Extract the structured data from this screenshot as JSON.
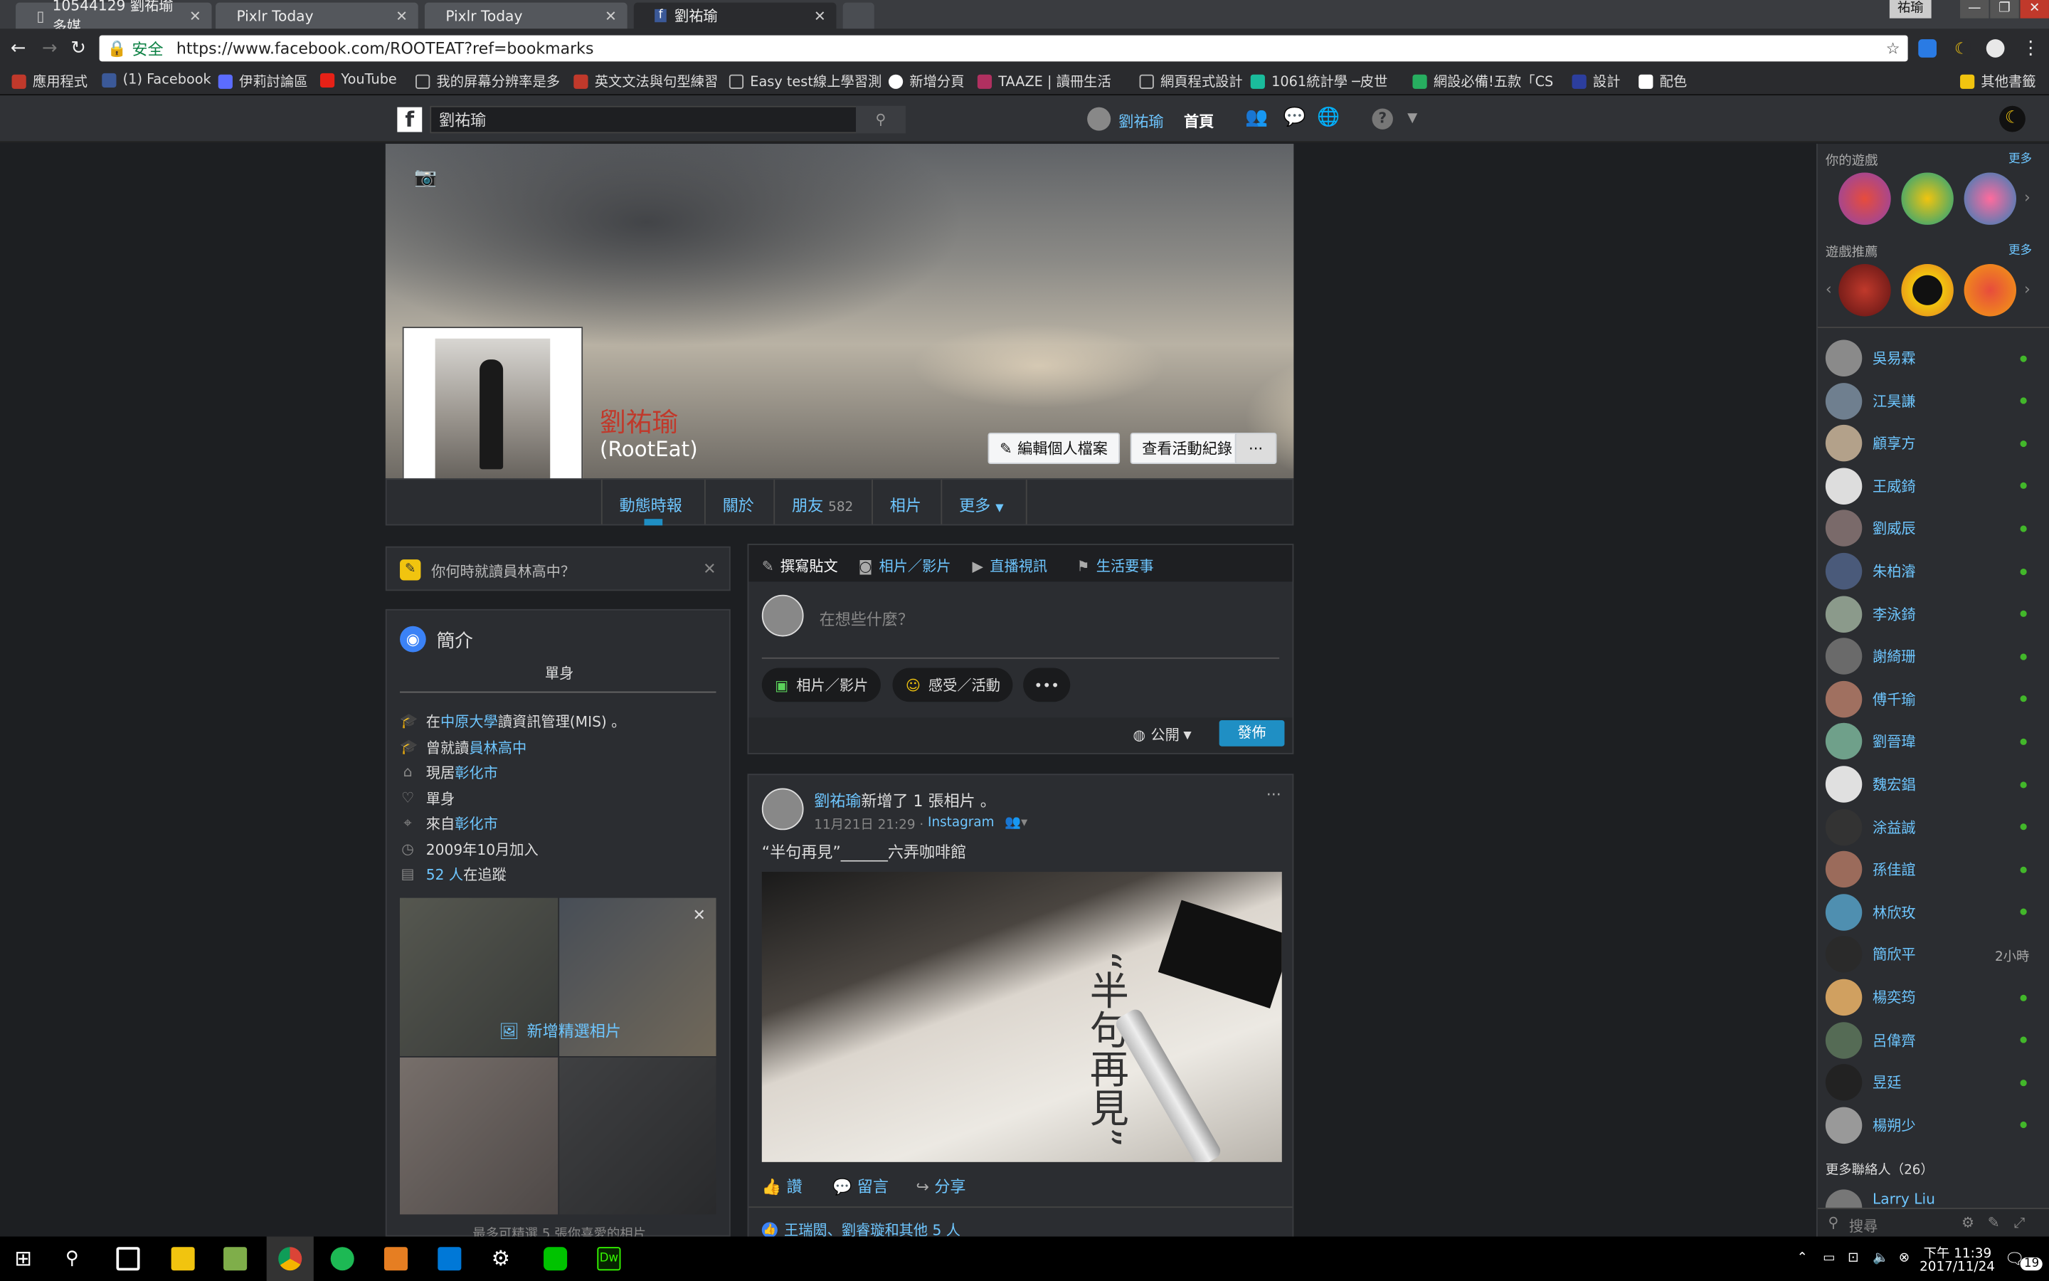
{
  "browser": {
    "tabs": [
      {
        "title": "10544129 劉祐瑜 多媒",
        "active": false
      },
      {
        "title": "Pixlr Today",
        "active": false
      },
      {
        "title": "Pixlr Today",
        "active": false
      },
      {
        "title": "劉祐瑜",
        "active": true
      }
    ],
    "user_chip": "祐瑜",
    "secure_label": "安全",
    "url": "https://www.facebook.com/ROOTEAT?ref=bookmarks",
    "bookmarks": [
      "應用程式",
      "(1) Facebook",
      "伊莉討論區",
      "YouTube",
      "我的屏幕分辨率是多",
      "英文文法與句型練習",
      "Easy test線上學習測",
      "新增分頁",
      "TAAZE | 讀冊生活",
      "網頁程式設計",
      "1061統計學 ─皮世",
      "網設必備!五款「CS",
      "設計",
      "配色"
    ],
    "other_bookmarks": "其他書籤"
  },
  "fb": {
    "search_value": "劉祐瑜",
    "header_user": "劉祐瑜",
    "header_home": "首頁"
  },
  "profile": {
    "name": "劉祐瑜",
    "handle": "(RootEat)",
    "edit_btn": "編輯個人檔案",
    "activity_btn": "查看活動紀錄",
    "more_btn": "···",
    "nav": {
      "timeline": "動態時報",
      "about": "關於",
      "friends": "朋友",
      "friends_count": "582",
      "photos": "相片",
      "more": "更多"
    }
  },
  "ask": {
    "text": "你何時就讀員林高中？"
  },
  "intro": {
    "title": "簡介",
    "bio": "單身",
    "study_prefix": "在",
    "study_school": "中原大學",
    "study_suffix": "讀資訊管理(MIS) 。",
    "studied_prefix": "曾就讀",
    "studied_school": "員林高中",
    "lives_prefix": "現居",
    "lives_city": "彰化市",
    "relationship": "單身",
    "from_prefix": "來自",
    "from_city": "彰化市",
    "joined": "2009年10月加入",
    "followers_link": "52 人",
    "followers_suffix": "在追蹤",
    "add_featured": "新增精選相片",
    "featured_hint": "最多可精選 5 張你喜愛的相片"
  },
  "composer": {
    "tab_post": "撰寫貼文",
    "tab_photo": "相片／影片",
    "tab_live": "直播視訊",
    "tab_event": "生活要事",
    "placeholder": "在想些什麼？",
    "btn_photo": "相片／影片",
    "btn_feeling": "感受／活動",
    "btn_more": "•••",
    "audience": "公開",
    "publish": "發佈"
  },
  "post": {
    "author": "劉祐瑜",
    "action": "新增了 1 張相片 。",
    "time": "11月21日 21:29 ·",
    "source": "Instagram",
    "caption": "“半句再見”______六弄咖啡館",
    "photo_text": "“半句再見”",
    "like": "讚",
    "comment": "留言",
    "share": "分享",
    "reactions": "王瑞閎、劉睿璇和其他 5 人"
  },
  "sidebar": {
    "your_games": "你的遊戲",
    "more": "更多",
    "game_recs": "遊戲推薦",
    "contacts": [
      {
        "name": "吳易霖",
        "status": "online"
      },
      {
        "name": "江昊謙",
        "status": "online"
      },
      {
        "name": "顧享方",
        "status": "online"
      },
      {
        "name": "王威錡",
        "status": "online"
      },
      {
        "name": "劉威辰",
        "status": "online"
      },
      {
        "name": "朱柏濬",
        "status": "online"
      },
      {
        "name": "李泳錡",
        "status": "online"
      },
      {
        "name": "謝綺珊",
        "status": "online"
      },
      {
        "name": "傅千瑜",
        "status": "online"
      },
      {
        "name": "劉晉瑋",
        "status": "online"
      },
      {
        "name": "魏宏錩",
        "status": "online"
      },
      {
        "name": "涂益誠",
        "status": "online"
      },
      {
        "name": "孫佳誼",
        "status": "online"
      },
      {
        "name": "林欣玫",
        "status": "online"
      },
      {
        "name": "簡欣平",
        "status": "2小時"
      },
      {
        "name": "楊奕筠",
        "status": "online"
      },
      {
        "name": "呂偉齊",
        "status": "online"
      },
      {
        "name": "昱廷",
        "status": "online"
      },
      {
        "name": "楊朔少",
        "status": "online"
      }
    ],
    "more_contacts": "更多聯絡人（26）",
    "partial_contact": "Larry Liu",
    "search_placeholder": "搜尋"
  },
  "taskbar": {
    "time": "下午 11:39",
    "date": "2017/11/24",
    "notifications": "19"
  },
  "colors": {
    "link": "#6ec6ff",
    "online": "#42b72a",
    "publish": "#1f8fc4",
    "name": "#c0392b"
  }
}
